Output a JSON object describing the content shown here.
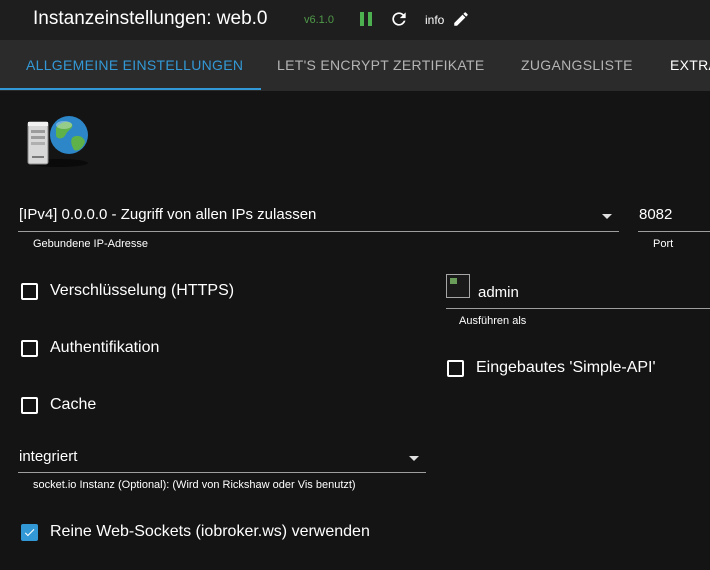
{
  "header": {
    "title": "Instanzeinstellungen: web.0",
    "version": "v6.1.0",
    "info_label": "info",
    "icons": [
      "pause-icon",
      "reload-icon",
      "pencil-icon"
    ],
    "colors": {
      "accent": "#3399d6",
      "running": "#4caf50",
      "background": "#141414"
    }
  },
  "tabs": [
    {
      "label": "ALLGEMEINE EINSTELLUNGEN",
      "active": true
    },
    {
      "label": "LET'S ENCRYPT ZERTIFIKATE",
      "active": false
    },
    {
      "label": "ZUGANGSLISTE",
      "active": false
    },
    {
      "label": "EXTRA",
      "active": false
    }
  ],
  "form": {
    "bind": {
      "value": "[IPv4] 0.0.0.0 - Zugriff von allen IPs zulassen",
      "helper": "Gebundene IP-Adresse"
    },
    "port": {
      "value": "8082",
      "helper": "Port"
    },
    "https": {
      "label": "Verschlüsselung (HTTPS)",
      "checked": false
    },
    "auth": {
      "label": "Authentifikation",
      "checked": false
    },
    "cache": {
      "label": "Cache",
      "checked": false
    },
    "user": {
      "value": "admin",
      "helper": "Ausführen als"
    },
    "simple_api": {
      "label": "Eingebautes 'Simple-API'",
      "checked": false
    },
    "socketio": {
      "value": "integriert",
      "helper": "socket.io Instanz (Optional): (Wird von Rickshaw oder Vis benutzt)"
    },
    "web_sockets": {
      "label": "Reine Web-Sockets (iobroker.ws) verwenden",
      "checked": true
    }
  }
}
